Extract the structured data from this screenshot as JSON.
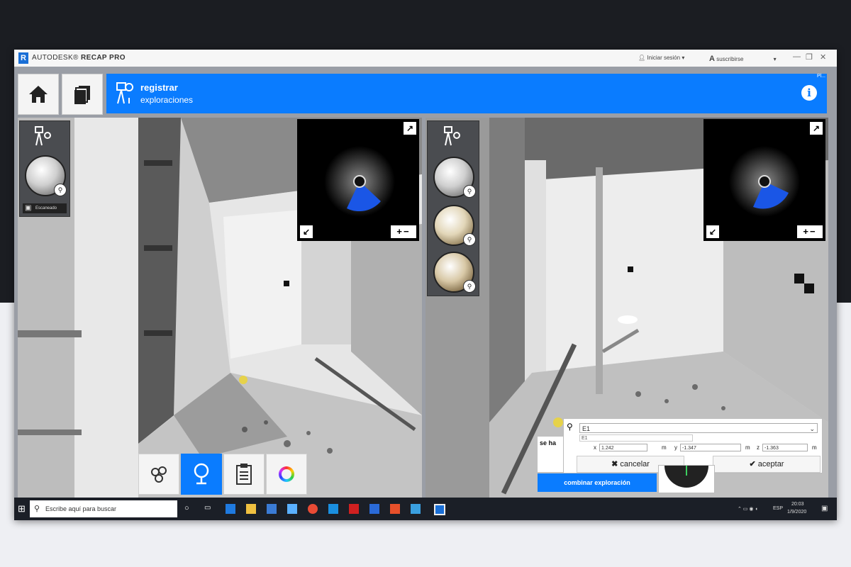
{
  "window": {
    "brand_light": "AUTODESK®",
    "brand_bold": "RECAP PRO",
    "login": "Iniciar sesión",
    "subscribe": "suscribirse",
    "controls": [
      "—",
      "❐",
      "✕"
    ]
  },
  "header": {
    "title": "registrar",
    "subtitle": "exploraciones",
    "info_icon": "info-icon",
    "corner": "Pl...",
    "accent": "#0a7cff"
  },
  "left_panel": {
    "thumb_label": "Escaneado"
  },
  "dialog": {
    "search_value": "E1",
    "sub_value": "E1",
    "x_label": "x",
    "x_value": "1.242",
    "y_label": "y",
    "y_value": "-1.347",
    "z_label": "z",
    "z_value": "-1.363",
    "unit": "m",
    "cancel_label": "cancelar",
    "accept_label": "aceptar",
    "se_ha": "se ha",
    "merge_label": "combinar exploración"
  },
  "taskbar": {
    "search_placeholder": "Escribe aquí para buscar",
    "lang": "ESP",
    "time": "20:03",
    "date": "1/9/2020"
  }
}
